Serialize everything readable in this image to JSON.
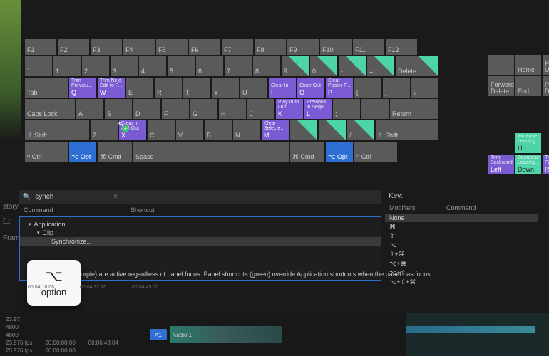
{
  "fnrow": [
    "F1",
    "F2",
    "F3",
    "F4",
    "F5",
    "F6",
    "F7",
    "F8",
    "F9",
    "F10",
    "F11",
    "F12"
  ],
  "row1": {
    "keys": [
      "`",
      "1",
      "2",
      "3",
      "4",
      "5",
      "6",
      "7",
      "8",
      "9",
      "0",
      "-",
      "=",
      "Delete"
    ],
    "teal": [
      9,
      10,
      11,
      12,
      13
    ]
  },
  "row2": {
    "tab": "Tab",
    "keys": [
      {
        "l": "Q",
        "a": "Trim Previou...",
        "c": "purple"
      },
      {
        "l": "W",
        "a": "Trim Next Edit to P...",
        "c": "purple"
      },
      {
        "l": "E"
      },
      {
        "l": "R"
      },
      {
        "l": "T"
      },
      {
        "l": "Y"
      },
      {
        "l": "U"
      },
      {
        "l": "I",
        "a": "Clear In",
        "c": "purple"
      },
      {
        "l": "O",
        "a": "Clear Out",
        "c": "purple"
      },
      {
        "l": "P",
        "a": "Clear Poster F...",
        "c": "purple"
      },
      {
        "l": "["
      },
      {
        "l": "]"
      },
      {
        "l": "\\"
      }
    ]
  },
  "row3": {
    "caps": "Caps Lock",
    "keys": [
      {
        "l": "A"
      },
      {
        "l": "S"
      },
      {
        "l": "D"
      },
      {
        "l": "F"
      },
      {
        "l": "G"
      },
      {
        "l": "H"
      },
      {
        "l": "J"
      },
      {
        "l": "K",
        "a": "Play In to Out",
        "c": "purple"
      },
      {
        "l": "L",
        "a": "Previous in Sequ...",
        "c": "purple"
      },
      {
        "l": ";"
      },
      {
        "l": "'"
      }
    ],
    "ret": "Return"
  },
  "row4": {
    "shiftL": "⇧ Shift",
    "keys": [
      {
        "l": "Z"
      },
      {
        "l": "X",
        "a": "Clear In and Out",
        "c": "purple"
      },
      {
        "l": "C"
      },
      {
        "l": "V"
      },
      {
        "l": "B"
      },
      {
        "l": "N"
      },
      {
        "l": "M",
        "a": "Clear Selecte...",
        "c": "purple"
      },
      {
        "l": ",",
        "c": "teal"
      },
      {
        "l": ".",
        "c": "teal"
      },
      {
        "l": "/",
        "c": "teal"
      }
    ],
    "shiftR": "⇧ Shift"
  },
  "row5": {
    "ctrlL": "^ Ctrl",
    "optL": "⌥ Opt",
    "cmdL": "⌘ Cmd",
    "space": "Space",
    "cmdR": "⌘ Cmd",
    "optR": "⌥ Opt",
    "ctrlR": "^ Ctrl"
  },
  "navTop": {
    "home": "Home",
    "pgup": "Page Up"
  },
  "navMid": {
    "fdel": "Forward Delete",
    "end": "End",
    "pgdn": "Page Down"
  },
  "arrows": {
    "up": {
      "l": "Up",
      "a": "Increase Leading...",
      "c": "tealfull"
    },
    "left": {
      "l": "Left",
      "a": "Trim Backward",
      "c": "purple"
    },
    "down": {
      "l": "Down",
      "a": "Decrease Leading...",
      "c": "tealfull"
    },
    "right": {
      "l": "Right",
      "a": "Trim Forward",
      "c": "purple"
    }
  },
  "search": {
    "value": "synch",
    "placeholder": "Search"
  },
  "cols": {
    "cmd": "Command",
    "sc": "Shortcut"
  },
  "tree": {
    "app": "Application",
    "clip": "Clip",
    "sync": "Synchronize..."
  },
  "keypanel": {
    "title": "Key:",
    "mod": "Modifiers",
    "cmd": "Command",
    "rows": [
      "None",
      "⌘",
      "⇧",
      "⌥",
      "⇧+⌘",
      "⌥+⌘",
      "⌥+⇧",
      "⌥+⇧+⌘"
    ]
  },
  "hint": "(purple) are active regardless of panel focus. Panel shortcuts (green) override Application shortcuts when the panel has focus.",
  "optkey": {
    "sym": "⌥",
    "label": "option"
  },
  "bottom": {
    "fps1": "23.97",
    "fps2": "4800",
    "fps3": "4800",
    "r1a": "23.976 fps",
    "r1b": "00:00:00:00",
    "r1c": "00:06:43:04",
    "r2a": "23.976 fps",
    "r2b": "00:00:00:00",
    "a1": "A1",
    "track": "Audio 1"
  },
  "left": {
    "story": "story",
    "frame": "Frame"
  },
  "timecodes": [
    "00:04:16:08",
    "00:04:32:16",
    "00:04:49:00"
  ]
}
